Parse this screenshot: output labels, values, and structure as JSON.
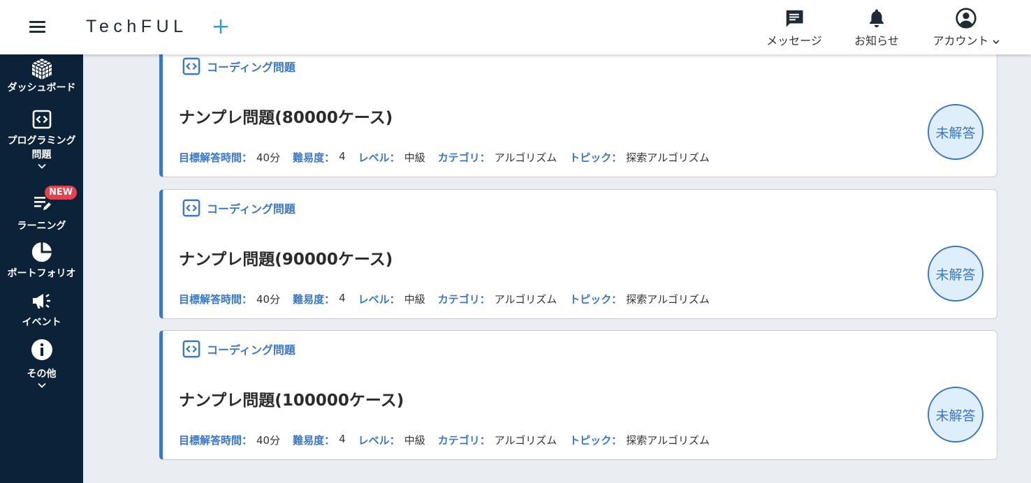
{
  "header": {
    "logo": "TechFUL",
    "nav": [
      {
        "label": "メッセージ",
        "icon": "message-icon"
      },
      {
        "label": "お知らせ",
        "icon": "bell-icon"
      },
      {
        "label": "アカウント",
        "icon": "account-icon"
      }
    ]
  },
  "sidebar": {
    "items": [
      {
        "label": "ダッシュボード",
        "icon": "cube-icon"
      },
      {
        "label": "プログラミング",
        "label2": "問題",
        "icon": "code-icon"
      },
      {
        "label": "ラーニング",
        "icon": "learning-icon",
        "badge": "NEW"
      },
      {
        "label": "ポートフォリオ",
        "icon": "pie-chart-icon"
      },
      {
        "label": "イベント",
        "icon": "megaphone-icon"
      },
      {
        "label": "その他",
        "icon": "info-icon"
      }
    ]
  },
  "problems": [
    {
      "type": "コーディング問題",
      "title": "ナンプレ問題(80000ケース)",
      "status": "未解答",
      "meta": {
        "time_label": "目標解答時間：",
        "time": "40分",
        "difficulty_label": "難易度：",
        "difficulty": "4",
        "level_label": "レベル：",
        "level": "中級",
        "category_label": "カテゴリ：",
        "category": "アルゴリズム",
        "topic_label": "トピック：",
        "topic": "探索アルゴリズム"
      }
    },
    {
      "type": "コーディング問題",
      "title": "ナンプレ問題(90000ケース)",
      "status": "未解答",
      "meta": {
        "time_label": "目標解答時間：",
        "time": "40分",
        "difficulty_label": "難易度：",
        "difficulty": "4",
        "level_label": "レベル：",
        "level": "中級",
        "category_label": "カテゴリ：",
        "category": "アルゴリズム",
        "topic_label": "トピック：",
        "topic": "探索アルゴリズム"
      }
    },
    {
      "type": "コーディング問題",
      "title": "ナンプレ問題(100000ケース)",
      "status": "未解答",
      "meta": {
        "time_label": "目標解答時間：",
        "time": "40分",
        "difficulty_label": "難易度：",
        "difficulty": "4",
        "level_label": "レベル：",
        "level": "中級",
        "category_label": "カテゴリ：",
        "category": "アルゴリズム",
        "topic_label": "トピック：",
        "topic": "探索アルゴリズム"
      }
    }
  ],
  "colors": {
    "accent": "#3a78c3",
    "sidebar": "#0b2238",
    "badge": "#e9414b",
    "logo_plus_blue": "#1ba1e2"
  }
}
